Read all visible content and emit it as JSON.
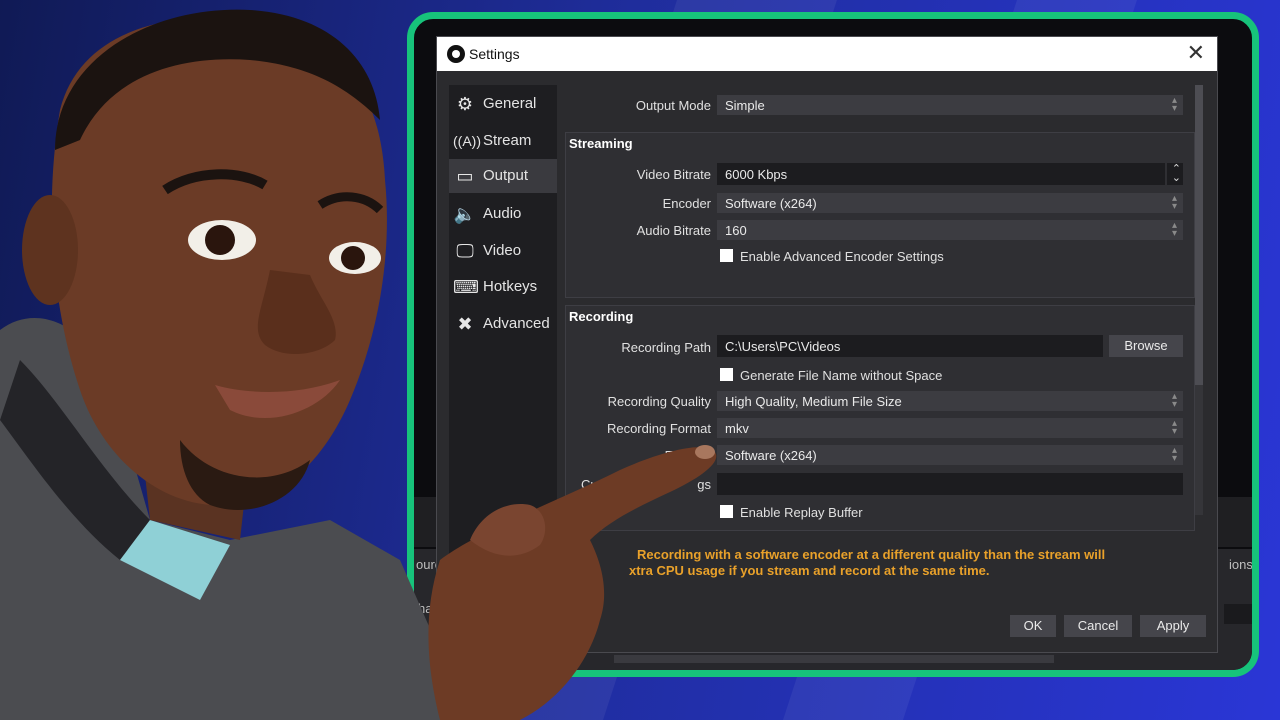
{
  "window": {
    "title": "Settings"
  },
  "sidebar": {
    "items": [
      {
        "label": "General",
        "icon": "gear-icon"
      },
      {
        "label": "Stream",
        "icon": "antenna-icon"
      },
      {
        "label": "Output",
        "icon": "output-monitor-icon"
      },
      {
        "label": "Audio",
        "icon": "speaker-icon"
      },
      {
        "label": "Video",
        "icon": "monitor-icon"
      },
      {
        "label": "Hotkeys",
        "icon": "keyboard-icon"
      },
      {
        "label": "Advanced",
        "icon": "tools-icon"
      }
    ],
    "active": "Output"
  },
  "output": {
    "mode_label": "Output Mode",
    "mode_value": "Simple"
  },
  "streaming": {
    "title": "Streaming",
    "video_bitrate_label": "Video Bitrate",
    "video_bitrate_value": "6000 Kbps",
    "encoder_label": "Encoder",
    "encoder_value": "Software (x264)",
    "audio_bitrate_label": "Audio Bitrate",
    "audio_bitrate_value": "160",
    "advanced_checkbox_label": "Enable Advanced Encoder Settings"
  },
  "recording": {
    "title": "Recording",
    "path_label": "Recording Path",
    "path_value": "C:\\Users\\PC\\Videos",
    "browse_label": "Browse",
    "no_space_label": "Generate File Name without Space",
    "quality_label": "Recording Quality",
    "quality_value": "High Quality, Medium File Size",
    "format_label": "Recording Format",
    "format_value": "mkv",
    "encoder_label_partial": "Enc",
    "encoder_value": "Software (x264)",
    "muxer_label_partial_a": "Custom Mu",
    "muxer_label_partial_b": "gs",
    "replay_label": "Enable Replay Buffer"
  },
  "warning": {
    "line1": "Recording with a software encoder at a different quality than the stream will",
    "line2": "xtra CPU usage if you stream and record at the same time."
  },
  "buttons": {
    "ok": "OK",
    "cancel": "Cancel",
    "apply": "Apply"
  },
  "background_obs": {
    "left_tab_partial": "ourc",
    "right_tab_partial": "ions",
    "snippet1": "hav",
    "snippet2": "+ |",
    "snippet3": "k"
  },
  "colors": {
    "frame_green": "#17c37b",
    "dialog_bg": "#2b2b2e",
    "warning_orange": "#e9a12a",
    "bg_blue": "#2a36d6"
  }
}
